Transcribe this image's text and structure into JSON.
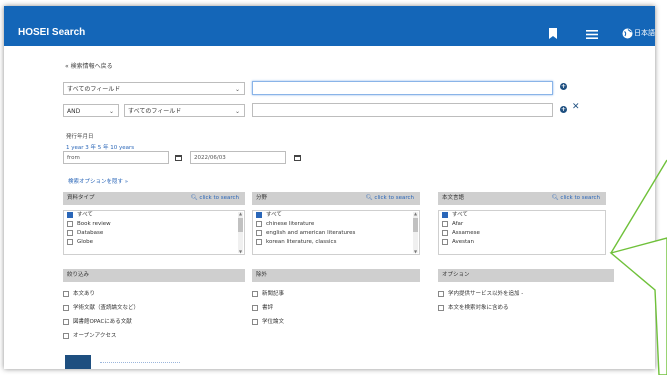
{
  "header": {
    "logo": "HOSEI Search",
    "language": "日本語"
  },
  "back_link": "« 検索情報へ戻る",
  "search_row1": {
    "field": "すべてのフィールド",
    "value": ""
  },
  "search_row2": {
    "operator": "AND",
    "field": "すべてのフィールド",
    "value": ""
  },
  "date": {
    "label": "発行年月日",
    "years": "1 year  3 年  5 年  10 years",
    "from_placeholder": "from",
    "to_value": "2022/06/03"
  },
  "options_link": "検索オプションを隠す »",
  "facets": [
    {
      "title": "資料タイプ",
      "search": "click to search",
      "items": [
        "すべて",
        "Book review",
        "Database",
        "Globe"
      ]
    },
    {
      "title": "分野",
      "search": "click to search",
      "items": [
        "すべて",
        "chinese literature",
        "english and american literatures",
        "korean literature, classics"
      ]
    },
    {
      "title": "本文言語",
      "search": "click to search",
      "items": [
        "すべて",
        "Afar",
        "Assamese",
        "Avestan"
      ]
    }
  ],
  "refine": {
    "title": "絞り込み",
    "items": [
      "本文あり",
      "学術文献（査読論文など）",
      "図書館OPACにある文献",
      "オープンアクセス"
    ]
  },
  "exclude": {
    "title": "除外",
    "items": [
      "新聞記事",
      "書評",
      "学位論文"
    ]
  },
  "options": {
    "title": "オプション",
    "items": [
      "学内提供サービス以外を追加 -",
      "本文を検索対象に含める"
    ]
  },
  "colors": {
    "topbar": "#1466b8",
    "link": "#2a66b8",
    "dark_blue": "#1e4f80",
    "arrow": "#6fc13a"
  }
}
